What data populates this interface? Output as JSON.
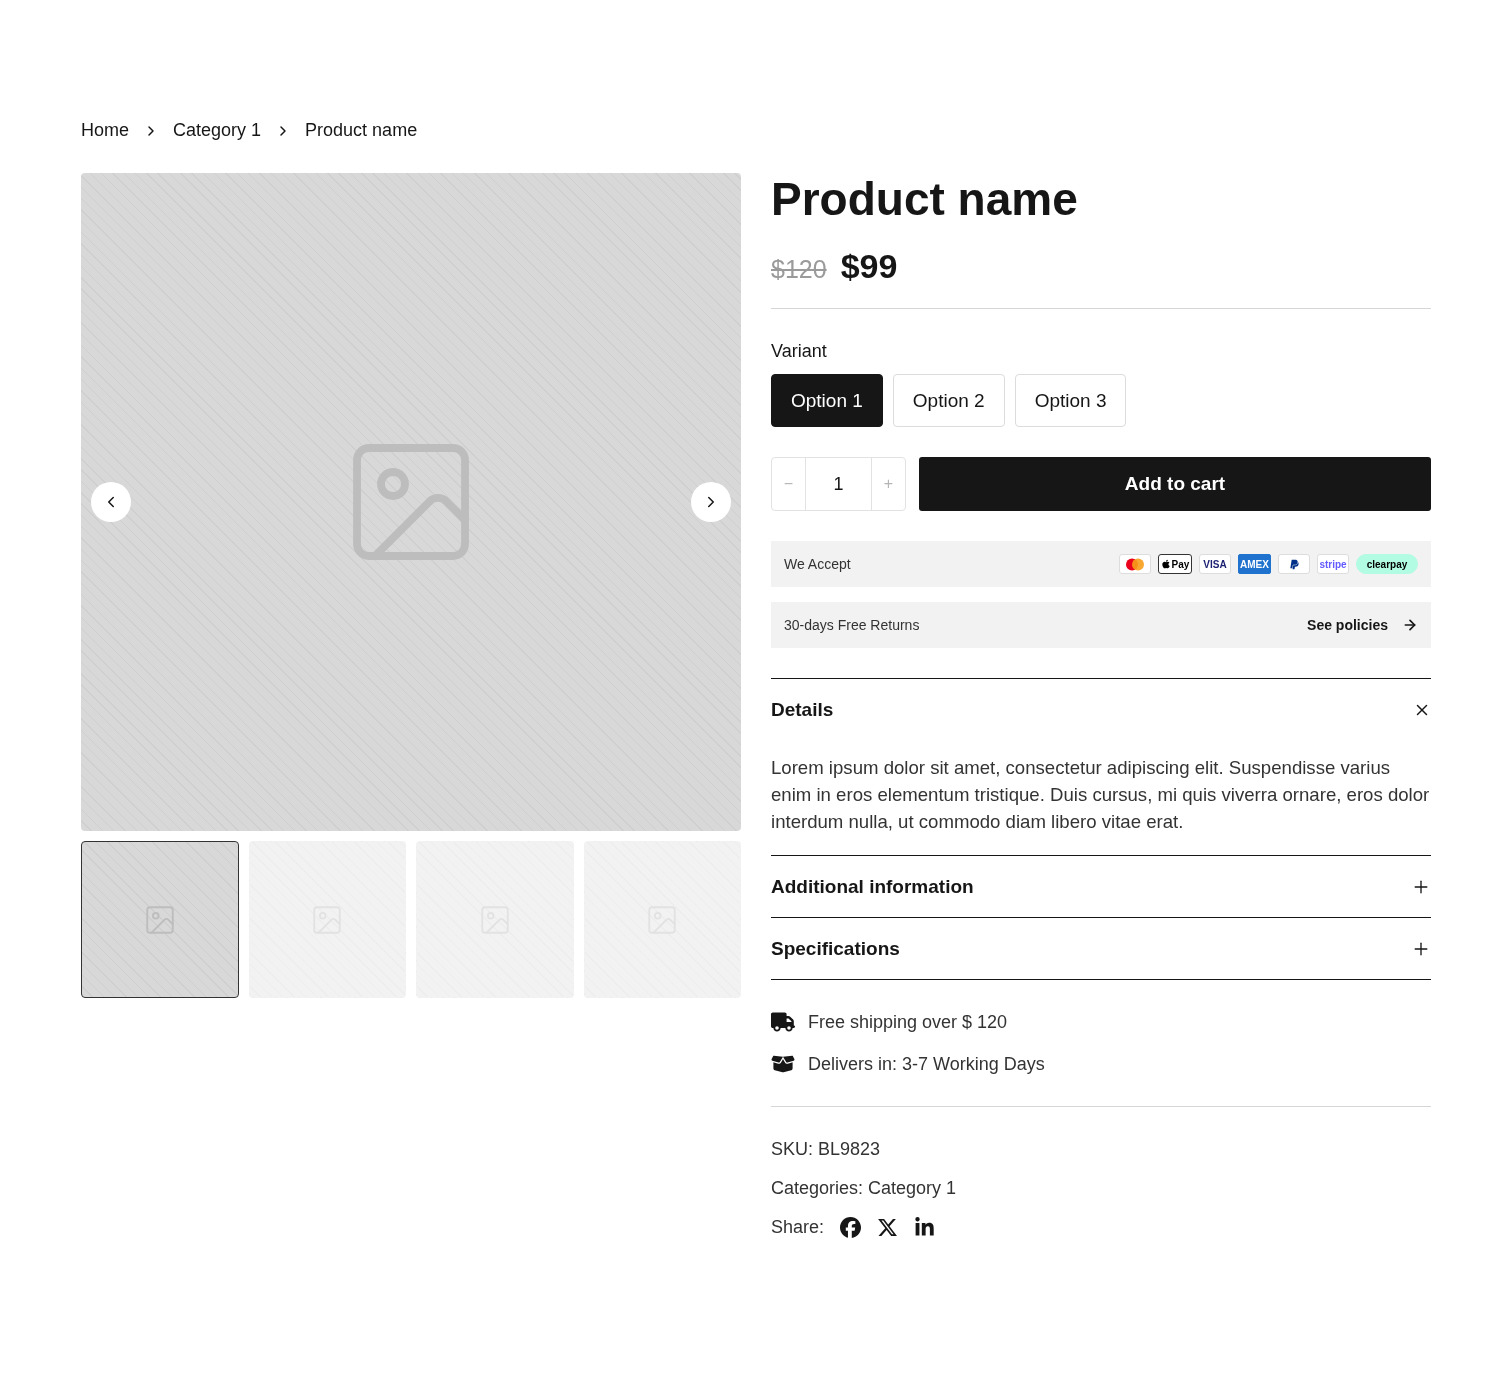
{
  "breadcrumb": [
    {
      "label": "Home"
    },
    {
      "label": "Category 1"
    },
    {
      "label": "Product name"
    }
  ],
  "gallery": {
    "thumbnails": [
      {
        "selected": true
      },
      {
        "selected": false
      },
      {
        "selected": false
      },
      {
        "selected": false
      }
    ]
  },
  "product": {
    "title": "Product name",
    "old_price": "$120",
    "price": "$99"
  },
  "variant": {
    "label": "Variant",
    "options": [
      {
        "label": "Option 1",
        "selected": true
      },
      {
        "label": "Option 2",
        "selected": false
      },
      {
        "label": "Option 3",
        "selected": false
      }
    ]
  },
  "quantity": {
    "minus": "−",
    "value": "1",
    "plus": "+"
  },
  "add_to_cart": "Add to cart",
  "payments": {
    "label": "We Accept",
    "methods": [
      {
        "kind": "mastercard"
      },
      {
        "kind": "applepay",
        "label": "Pay"
      },
      {
        "kind": "visa",
        "label": "VISA"
      },
      {
        "kind": "amex",
        "label": "AMEX"
      },
      {
        "kind": "paypal"
      },
      {
        "kind": "stripe",
        "label": "stripe"
      },
      {
        "kind": "clearpay",
        "label": "clearpay"
      }
    ]
  },
  "returns": {
    "label": "30-days Free Returns",
    "link": "See policies"
  },
  "accordion": [
    {
      "title": "Details",
      "expanded": true,
      "body": "Lorem ipsum dolor sit amet, consectetur adipiscing elit. Suspendisse varius enim in eros elementum tristique. Duis cursus, mi quis viverra ornare, eros dolor interdum nulla, ut commodo diam libero vitae erat."
    },
    {
      "title": "Additional information",
      "expanded": false
    },
    {
      "title": "Specifications",
      "expanded": false
    }
  ],
  "delivery": [
    {
      "kind": "truck",
      "text": "Free shipping over $ 120"
    },
    {
      "kind": "box",
      "text": "Delivers in: 3-7 Working Days"
    }
  ],
  "meta": {
    "sku": "SKU: BL9823",
    "categories": "Categories: Category 1",
    "share_label": "Share:",
    "share": [
      {
        "kind": "facebook"
      },
      {
        "kind": "x"
      },
      {
        "kind": "linkedin"
      }
    ]
  }
}
